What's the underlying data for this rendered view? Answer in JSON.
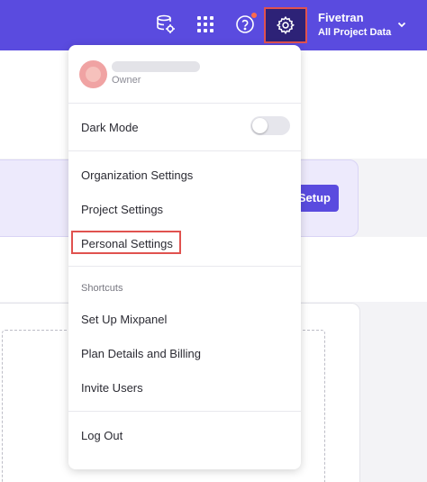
{
  "topbar": {
    "icons": [
      "database-settings-icon",
      "apps-grid-icon",
      "help-icon",
      "gear-icon"
    ],
    "project_name": "Fivetran",
    "project_scope": "All Project Data"
  },
  "background": {
    "setup_button": "Setup"
  },
  "menu": {
    "user": {
      "name": "",
      "role": "Owner"
    },
    "dark_mode_label": "Dark Mode",
    "dark_mode_on": false,
    "settings_items": [
      "Organization Settings",
      "Project Settings",
      "Personal Settings"
    ],
    "shortcuts_label": "Shortcuts",
    "shortcut_items": [
      "Set Up Mixpanel",
      "Plan Details and Billing",
      "Invite Users"
    ],
    "logout_label": "Log Out"
  },
  "colors": {
    "accent": "#5a4bdf",
    "highlight": "#e0524f"
  }
}
